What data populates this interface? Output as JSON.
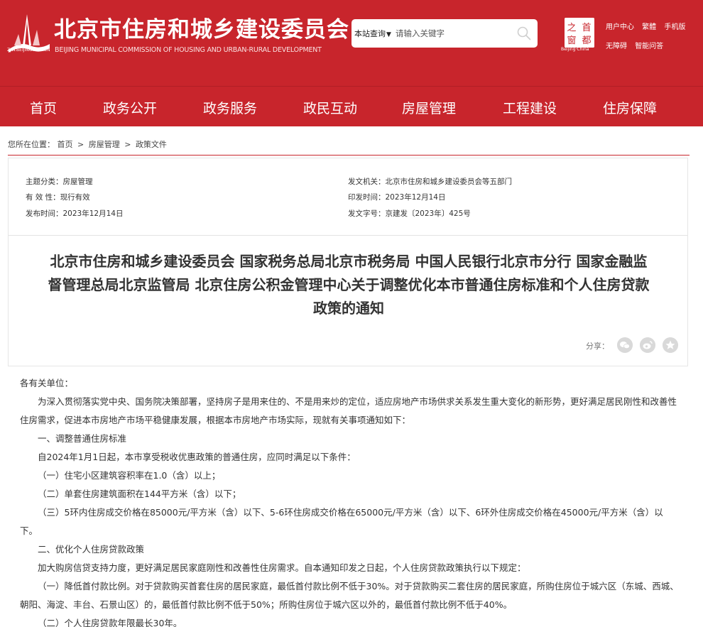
{
  "header": {
    "title": "北京市住房和城乡建设委员会",
    "subtitle": "BEIJING MUNICIPAL COMMISSION OF HOUSING AND URBAN-RURAL DEVELOPMENT",
    "logo_domain": "ZJW.BEIJING.GOV.CN",
    "search_scope": "本站查询",
    "search_placeholder": "请输入关键字",
    "capital_caption": "Beijing·China",
    "capital_chars": "首都之窗",
    "links_row1": [
      "用户中心",
      "繁體",
      "手机版"
    ],
    "links_row2": [
      "无障碍",
      "智能问答"
    ]
  },
  "nav": [
    "首页",
    "政务公开",
    "政务服务",
    "政民互动",
    "房屋管理",
    "工程建设",
    "住房保障"
  ],
  "breadcrumb": {
    "prefix": "您所在位置：",
    "items": [
      "首页",
      "房屋管理",
      "政策文件"
    ],
    "separator": ">"
  },
  "info": {
    "category_label": "主题分类：",
    "category": "房屋管理",
    "validity_label": "有 效 性：",
    "validity": "现行有效",
    "published_label": "发布时间：",
    "published": "2023年12月14日",
    "issuer_label": "发文机关：",
    "issuer": "北京市住房和城乡建设委员会等五部门",
    "print_date_label": "印发时间：",
    "print_date": "2023年12月14日",
    "doc_no_label": "发文字号：",
    "doc_no": "京建发〔2023年〕425号"
  },
  "article": {
    "title_lines": [
      "北京市住房和城乡建设委员会 国家税务总局北京市税务局 中国人民银行北京市分行 国家金融监",
      "督管理总局北京监管局 北京住房公积金管理中心关于调整优化本市普通住房标准和个人住房贷款",
      "政策的通知"
    ],
    "share_label": "分享：",
    "share_icons": [
      "wechat-icon",
      "weibo-icon",
      "qzone-icon"
    ],
    "paragraphs": [
      "各有关单位：",
      "为深入贯彻落实党中央、国务院决策部署，坚持房子是用来住的、不是用来炒的定位，适应房地产市场供求关系发生重大变化的新形势，更好满足居民刚性和改善性住房需求，促进本市房地产市场平稳健康发展，根据本市房地产市场实际，现就有关事项通知如下：",
      "一、调整普通住房标准",
      "自2024年1月1日起，本市享受税收优惠政策的普通住房，应同时满足以下条件：",
      "（一）住宅小区建筑容积率在1.0（含）以上；",
      "（二）单套住房建筑面积在144平方米（含）以下；",
      "（三）5环内住房成交价格在85000元/平方米（含）以下、5-6环住房成交价格在65000元/平方米（含）以下、6环外住房成交价格在45000元/平方米（含）以下。",
      "二、优化个人住房贷款政策",
      "加大购房信贷支持力度，更好满足居民家庭刚性和改善性住房需求。自本通知印发之日起，个人住房贷款政策执行以下规定：",
      "（一）降低首付款比例。对于贷款购买首套住房的居民家庭，最低首付款比例不低于30%。对于贷款购买二套住房的居民家庭，所购住房位于城六区（东城、西城、朝阳、海淀、丰台、石景山区）的，最低首付款比例不低于50%；所购住房位于城六区以外的，最低首付款比例不低于40%。",
      "（二）个人住房贷款年限最长30年。"
    ]
  },
  "colors": {
    "brand_red": "#c8252c",
    "text": "#333333"
  }
}
